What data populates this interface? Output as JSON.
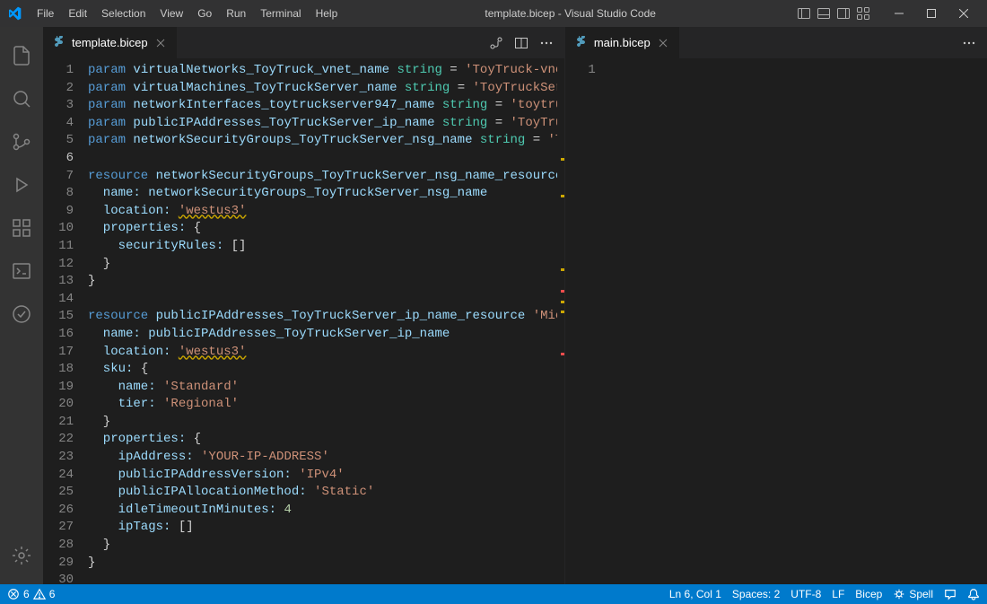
{
  "titlebar": {
    "menus": [
      "File",
      "Edit",
      "Selection",
      "View",
      "Go",
      "Run",
      "Terminal",
      "Help"
    ],
    "title": "template.bicep - Visual Studio Code"
  },
  "tabs_left": {
    "tab_label": "template.bicep"
  },
  "tabs_right": {
    "tab_label": "main.bicep"
  },
  "editor_left": {
    "lines": [
      {
        "n": "1",
        "tokens": [
          {
            "t": "param ",
            "c": "kw"
          },
          {
            "t": "virtualNetworks_ToyTruck_vnet_name",
            "c": "var"
          },
          {
            "t": " string",
            "c": "type"
          },
          {
            "t": " = ",
            "c": "punc"
          },
          {
            "t": "'ToyTruck-vnet",
            "c": "str"
          }
        ]
      },
      {
        "n": "2",
        "tokens": [
          {
            "t": "param ",
            "c": "kw"
          },
          {
            "t": "virtualMachines_ToyTruckServer_name",
            "c": "var"
          },
          {
            "t": " string",
            "c": "type"
          },
          {
            "t": " = ",
            "c": "punc"
          },
          {
            "t": "'ToyTruckSer",
            "c": "str"
          }
        ]
      },
      {
        "n": "3",
        "tokens": [
          {
            "t": "param ",
            "c": "kw"
          },
          {
            "t": "networkInterfaces_toytruckserver947_name",
            "c": "var"
          },
          {
            "t": " string",
            "c": "type"
          },
          {
            "t": " = ",
            "c": "punc"
          },
          {
            "t": "'toytru",
            "c": "str"
          }
        ]
      },
      {
        "n": "4",
        "tokens": [
          {
            "t": "param ",
            "c": "kw"
          },
          {
            "t": "publicIPAddresses_ToyTruckServer_ip_name",
            "c": "var"
          },
          {
            "t": " string",
            "c": "type"
          },
          {
            "t": " = ",
            "c": "punc"
          },
          {
            "t": "'ToyTru",
            "c": "str"
          }
        ]
      },
      {
        "n": "5",
        "tokens": [
          {
            "t": "param ",
            "c": "kw"
          },
          {
            "t": "networkSecurityGroups_ToyTruckServer_nsg_name",
            "c": "var"
          },
          {
            "t": " string",
            "c": "type"
          },
          {
            "t": " = ",
            "c": "punc"
          },
          {
            "t": "'T",
            "c": "str"
          }
        ]
      },
      {
        "n": "6",
        "current": true,
        "tokens": []
      },
      {
        "n": "7",
        "tokens": [
          {
            "t": "resource ",
            "c": "kw"
          },
          {
            "t": "networkSecurityGroups_ToyTruckServer_nsg_name_resource",
            "c": "var"
          }
        ]
      },
      {
        "n": "8",
        "tokens": [
          {
            "t": "  name: ",
            "c": "prop"
          },
          {
            "t": "networkSecurityGroups_ToyTruckServer_nsg_name",
            "c": "var"
          }
        ]
      },
      {
        "n": "9",
        "tokens": [
          {
            "t": "  location: ",
            "c": "prop"
          },
          {
            "t": "'westus3'",
            "c": "str warn-underline"
          }
        ]
      },
      {
        "n": "10",
        "tokens": [
          {
            "t": "  properties: ",
            "c": "prop"
          },
          {
            "t": "{",
            "c": "punc"
          }
        ]
      },
      {
        "n": "11",
        "tokens": [
          {
            "t": "    securityRules: ",
            "c": "prop"
          },
          {
            "t": "[]",
            "c": "punc"
          }
        ]
      },
      {
        "n": "12",
        "tokens": [
          {
            "t": "  }",
            "c": "punc"
          }
        ]
      },
      {
        "n": "13",
        "tokens": [
          {
            "t": "}",
            "c": "punc"
          }
        ]
      },
      {
        "n": "14",
        "tokens": []
      },
      {
        "n": "15",
        "tokens": [
          {
            "t": "resource ",
            "c": "kw"
          },
          {
            "t": "publicIPAddresses_ToyTruckServer_ip_name_resource",
            "c": "var"
          },
          {
            "t": " 'Mic",
            "c": "str"
          }
        ]
      },
      {
        "n": "16",
        "tokens": [
          {
            "t": "  name: ",
            "c": "prop"
          },
          {
            "t": "publicIPAddresses_ToyTruckServer_ip_name",
            "c": "var"
          }
        ]
      },
      {
        "n": "17",
        "tokens": [
          {
            "t": "  location: ",
            "c": "prop"
          },
          {
            "t": "'westus3'",
            "c": "str warn-underline"
          }
        ]
      },
      {
        "n": "18",
        "tokens": [
          {
            "t": "  sku: ",
            "c": "prop"
          },
          {
            "t": "{",
            "c": "punc"
          }
        ]
      },
      {
        "n": "19",
        "tokens": [
          {
            "t": "    name: ",
            "c": "prop"
          },
          {
            "t": "'Standard'",
            "c": "str"
          }
        ]
      },
      {
        "n": "20",
        "tokens": [
          {
            "t": "    tier: ",
            "c": "prop"
          },
          {
            "t": "'Regional'",
            "c": "str"
          }
        ]
      },
      {
        "n": "21",
        "tokens": [
          {
            "t": "  }",
            "c": "punc"
          }
        ]
      },
      {
        "n": "22",
        "tokens": [
          {
            "t": "  properties: ",
            "c": "prop"
          },
          {
            "t": "{",
            "c": "punc"
          }
        ]
      },
      {
        "n": "23",
        "tokens": [
          {
            "t": "    ipAddress: ",
            "c": "prop"
          },
          {
            "t": "'YOUR-IP-ADDRESS'",
            "c": "str"
          }
        ]
      },
      {
        "n": "24",
        "tokens": [
          {
            "t": "    publicIPAddressVersion: ",
            "c": "prop"
          },
          {
            "t": "'IPv4'",
            "c": "str"
          }
        ]
      },
      {
        "n": "25",
        "tokens": [
          {
            "t": "    publicIPAllocationMethod: ",
            "c": "prop"
          },
          {
            "t": "'Static'",
            "c": "str"
          }
        ]
      },
      {
        "n": "26",
        "tokens": [
          {
            "t": "    idleTimeoutInMinutes: ",
            "c": "prop"
          },
          {
            "t": "4",
            "c": "num"
          }
        ]
      },
      {
        "n": "27",
        "tokens": [
          {
            "t": "    ipTags: ",
            "c": "prop"
          },
          {
            "t": "[]",
            "c": "punc"
          }
        ]
      },
      {
        "n": "28",
        "tokens": [
          {
            "t": "  }",
            "c": "punc"
          }
        ]
      },
      {
        "n": "29",
        "tokens": [
          {
            "t": "}",
            "c": "punc"
          }
        ]
      },
      {
        "n": "30",
        "tokens": []
      }
    ]
  },
  "editor_right": {
    "lines": [
      {
        "n": "1",
        "tokens": []
      }
    ]
  },
  "statusbar": {
    "errors": "6",
    "warnings": "6",
    "ln_col": "Ln 6, Col 1",
    "spaces": "Spaces: 2",
    "encoding": "UTF-8",
    "eol": "LF",
    "language": "Bicep",
    "spell": "Spell"
  }
}
